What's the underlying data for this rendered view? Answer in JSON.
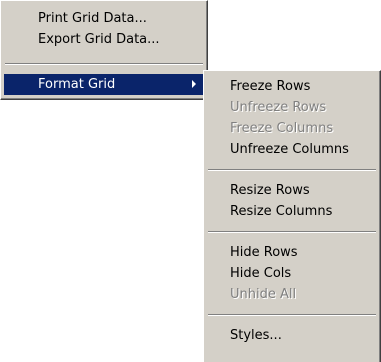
{
  "main_menu": {
    "items": [
      {
        "label": "Print Grid Data..."
      },
      {
        "label": "Export Grid Data..."
      },
      {
        "label": "Format Grid"
      }
    ]
  },
  "format_grid_submenu": {
    "items": [
      {
        "label": "Freeze Rows",
        "enabled": true
      },
      {
        "label": "Unfreeze Rows",
        "enabled": false
      },
      {
        "label": "Freeze Columns",
        "enabled": false
      },
      {
        "label": "Unfreeze Columns",
        "enabled": true
      },
      {
        "label": "Resize Rows",
        "enabled": true
      },
      {
        "label": "Resize Columns",
        "enabled": true
      },
      {
        "label": "Hide Rows",
        "enabled": true
      },
      {
        "label": "Hide Cols",
        "enabled": true
      },
      {
        "label": "Unhide All",
        "enabled": false
      },
      {
        "label": "Styles...",
        "enabled": true
      }
    ]
  },
  "colors": {
    "menu_bg": "#d4d0c8",
    "highlight_bg": "#0a246a",
    "disabled_text": "#808080"
  }
}
